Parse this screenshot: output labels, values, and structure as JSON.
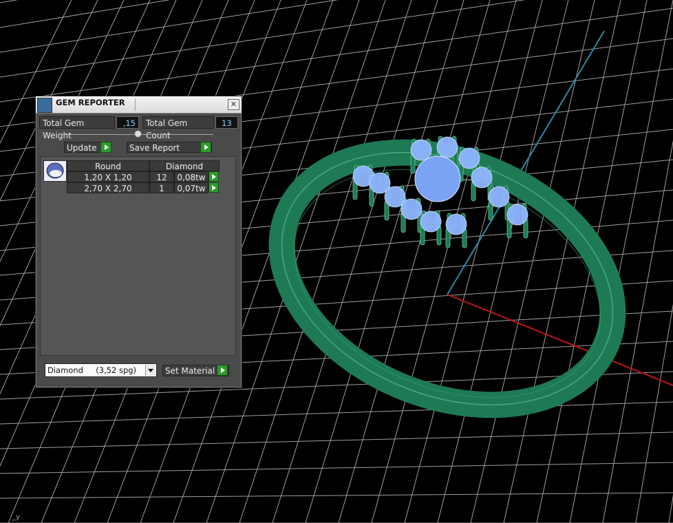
{
  "window": {
    "title": "GEM REPORTER",
    "icon": "gem-reporter-icon",
    "close_icon": "close-icon"
  },
  "totals": {
    "weight_label": "Total Gem Weight",
    "weight_value": ",15",
    "count_label": "Total Gem Count",
    "count_value": "13"
  },
  "buttons": {
    "update_label": "Update",
    "save_report_label": "Save Report",
    "set_material_label": "Set Material"
  },
  "report_table": {
    "headers": [
      "Round",
      "Diamond"
    ],
    "rows": [
      {
        "size": "1,20 X 1,20",
        "count": "12",
        "weight": "0,08tw"
      },
      {
        "size": "2,70 X 2,70",
        "count": "1",
        "weight": "0,07tw"
      }
    ]
  },
  "material_select": {
    "selected": "Diamond     (3,52 spg)"
  },
  "viewport": {
    "axis_label": "_y",
    "grid_color": "#bdbdbd",
    "ring_color": "#1e7a55",
    "gem_color": "#8fb6ff",
    "x_axis_color": "#c01818",
    "y_axis_color": "#2a8aa8"
  }
}
